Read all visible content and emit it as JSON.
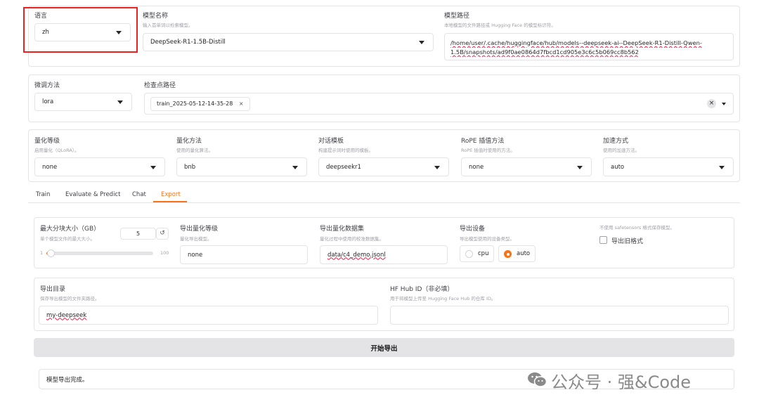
{
  "lang": {
    "label": "语言",
    "value": "zh"
  },
  "model_name": {
    "label": "模型名称",
    "hint": "输入首单词以检索模型。",
    "value": "DeepSeek-R1-1.5B-Distill"
  },
  "model_path": {
    "label": "模型路径",
    "hint": "本地模型的文件路径或 Hugging Face 的模型标识符。",
    "line1": "/home/user/.cache/huggingface/hub/models--deepseek-ai--DeepSeek-R1-Distill-Qwen-",
    "line2": "1.5B/snapshots/ad9f0ae0864d7fbcd1cd905e3c6c5b069cc8b562"
  },
  "finetune": {
    "label": "微调方法",
    "value": "lora"
  },
  "checkpoint": {
    "label": "检查点路径",
    "chip": "train_2025-05-12-14-35-28",
    "chip_remove": "×",
    "clear_icon": "×"
  },
  "quant_bit": {
    "label": "量化等级",
    "hint": "启用量化（QLoRA）。",
    "value": "none"
  },
  "quant_method": {
    "label": "量化方法",
    "hint": "使用的量化算法。",
    "value": "bnb"
  },
  "template": {
    "label": "对话模板",
    "hint": "构建提示词时使用的模板。",
    "value": "deepseekr1"
  },
  "rope": {
    "label": "RoPE 插值方法",
    "hint": "RoPE 插值时使用的方法。",
    "value": "none"
  },
  "booster": {
    "label": "加速方式",
    "hint": "使用的加速方法。",
    "value": "auto"
  },
  "tabs": [
    {
      "label": "Train"
    },
    {
      "label": "Evaluate & Predict"
    },
    {
      "label": "Chat"
    },
    {
      "label": "Export"
    }
  ],
  "export": {
    "shard": {
      "label": "最大分块大小（GB）",
      "hint": "单个模型文件的最大大小。",
      "value": "5",
      "reset_icon": "↺",
      "min": "1",
      "max": "100",
      "fraction": 0.04
    },
    "quant_bit": {
      "label": "导出量化等级",
      "hint": "量化导出模型。",
      "value": "none"
    },
    "quant_dataset": {
      "label": "导出量化数据集",
      "hint": "量化过程中使用的校准数据集。",
      "value": "data/c4_demo.jsonl"
    },
    "device": {
      "label": "导出设备",
      "hint": "导出模型使用的设备类型。",
      "opt_cpu": "cpu",
      "opt_auto": "auto",
      "selected": "auto"
    },
    "legacy": {
      "hint": "不使用 safetensors 格式保存模型。",
      "label": "导出旧格式",
      "checked": false
    },
    "dir": {
      "label": "导出目录",
      "hint": "保存导出模型的文件夹路径。",
      "value": "my-deepseek"
    },
    "hub": {
      "label": "HF Hub ID（非必填）",
      "hint": "用于将模型上传至 Hugging Face Hub 的仓库 ID。",
      "value": ""
    },
    "button": "开始导出",
    "output": "模型导出完成。"
  },
  "watermark": {
    "text": "公众号 · 强&Code"
  }
}
